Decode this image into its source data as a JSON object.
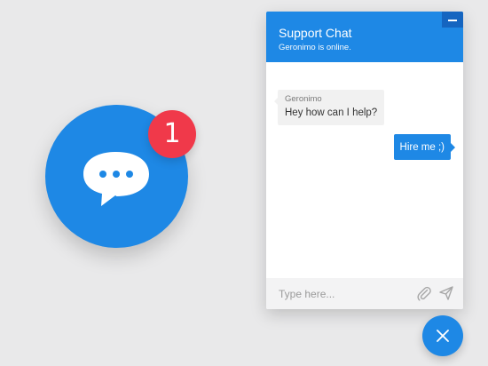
{
  "colors": {
    "background": "#e9e9ea",
    "accent": "#1e88e5",
    "accent_dark": "#1565c0",
    "badge": "#f0394a",
    "incoming_bubble": "#f1f1f1",
    "composer_bg": "#f3f3f4"
  },
  "launcher": {
    "icon": "chat-bubble-dots-icon",
    "badge_count": "1"
  },
  "chat": {
    "title": "Support Chat",
    "status": "Geronimo is online.",
    "minimize_icon": "minimize-icon",
    "messages": [
      {
        "direction": "incoming",
        "sender": "Geronimo",
        "text": "Hey how can I help?"
      },
      {
        "direction": "outgoing",
        "text": "Hire me ;)"
      }
    ],
    "composer": {
      "placeholder": "Type here...",
      "value": "",
      "attach_icon": "paperclip-icon",
      "send_icon": "send-icon"
    }
  },
  "close_fab": {
    "icon": "close-icon"
  }
}
